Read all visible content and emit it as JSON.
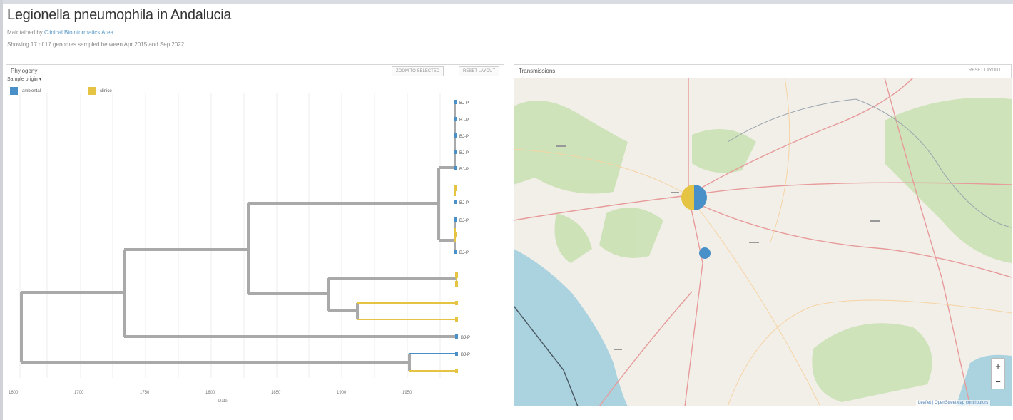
{
  "header": {
    "title": "Legionella pneumophila in Andalucia",
    "maintained_prefix": "Maintained by",
    "maintained_link": "Clinical Bioinformatics Area",
    "showing": "Showing 17 of 17 genomes sampled between Apr 2015 and Sep 2022."
  },
  "phylogeny": {
    "title": "Phylogeny",
    "btn_zoom": "ZOOM TO SELECTED",
    "btn_reset": "RESET LAYOUT",
    "color_by": "Sample origin",
    "legend": [
      {
        "label": "ambiental",
        "color": "#4a90c8"
      },
      {
        "label": "clinico",
        "color": "#e5c443"
      }
    ],
    "axis_label": "Date",
    "ticks": [
      "1600",
      "1700",
      "1750",
      "1800",
      "1850",
      "1900",
      "1950"
    ],
    "tip_label": "BJ-P"
  },
  "transmissions": {
    "title": "Transmissions",
    "btn_reset": "RESET LAYOUT",
    "zoom_in": "+",
    "zoom_out": "−",
    "attribution": "Leaflet | OpenStreetMap contributors"
  },
  "colors": {
    "branch": "#a9a9a9",
    "ambiental": "#4a90c8",
    "clinico": "#e5c443",
    "sea": "#aad3df",
    "land": "#f2efe9"
  }
}
